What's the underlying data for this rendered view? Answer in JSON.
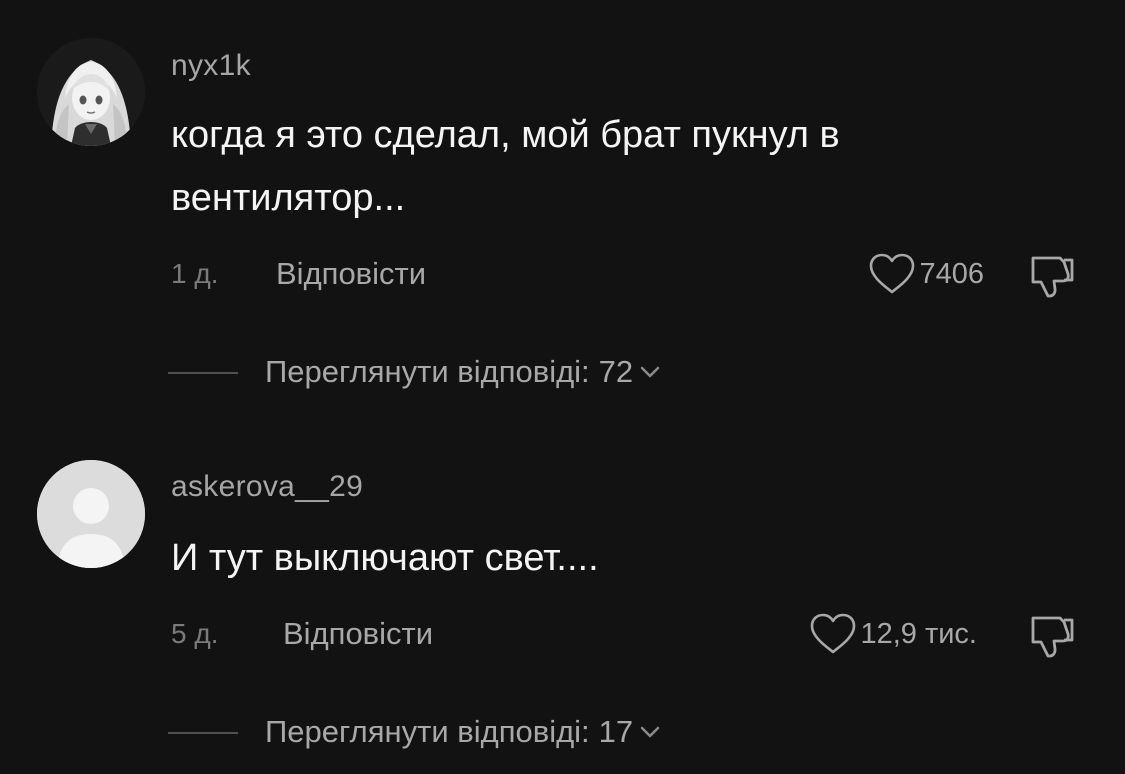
{
  "comments": [
    {
      "username": "nyx1k",
      "text": "когда я это сделал, мой брат пукнул в вентилятор...",
      "time": "1 д.",
      "reply_label": "Відповісти",
      "likes": "7406",
      "view_replies_label": "Переглянути відповіді:",
      "replies_count": "72",
      "avatar_icon": "anime-avatar-icon"
    },
    {
      "username": "askerova__29",
      "text": "И тут выключают свет....",
      "time": "5 д.",
      "reply_label": "Відповісти",
      "likes": "12,9 тис.",
      "view_replies_label": "Переглянути відповіді:",
      "replies_count": "17",
      "avatar_icon": "default-user-avatar-icon"
    }
  ],
  "icons": {
    "like": "heart-icon",
    "dislike": "thumbs-down-icon",
    "expand": "chevron-down-icon"
  },
  "colors": {
    "background": "#121212",
    "primary_text": "#f4f4f4",
    "secondary_text": "#a8a8a8",
    "muted_text": "#7a7a7a"
  }
}
